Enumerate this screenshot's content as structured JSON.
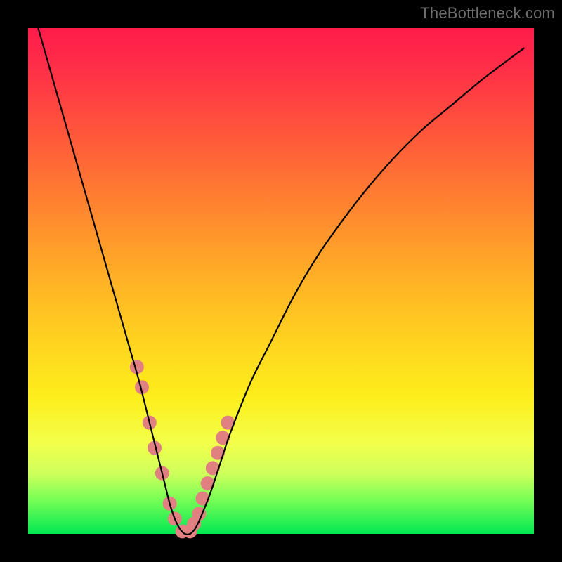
{
  "watermark": "TheBottleneck.com",
  "chart_data": {
    "type": "line",
    "title": "",
    "xlabel": "",
    "ylabel": "",
    "xlim": [
      0,
      100
    ],
    "ylim": [
      0,
      100
    ],
    "grid": false,
    "legend": false,
    "series": [
      {
        "name": "bottleneck-curve",
        "color": "#000000",
        "x": [
          2,
          4,
          6,
          8,
          10,
          12,
          14,
          16,
          18,
          20,
          22,
          24,
          25,
          26,
          27,
          28,
          29,
          30,
          31,
          32,
          33,
          34,
          36,
          38,
          40,
          44,
          48,
          52,
          56,
          60,
          66,
          72,
          78,
          84,
          90,
          98
        ],
        "y": [
          100,
          93,
          86,
          79,
          72,
          65,
          58,
          51,
          44,
          37,
          30,
          22,
          18,
          14,
          10,
          6,
          3,
          1,
          0,
          0,
          1,
          3,
          8,
          14,
          20,
          30,
          38,
          46,
          53,
          59,
          67,
          74,
          80,
          85,
          90,
          96
        ]
      }
    ],
    "markers": {
      "name": "highlight-dots",
      "color": "#e08080",
      "radius_px": 10,
      "x": [
        21.5,
        22.5,
        24.0,
        25.0,
        26.5,
        28.0,
        29.0,
        30.5,
        32.0,
        32.8,
        33.8,
        34.5,
        35.5,
        36.5,
        37.5,
        38.5,
        39.5
      ],
      "y": [
        33,
        29,
        22,
        17,
        12,
        6,
        3,
        0.5,
        0.5,
        2,
        4,
        7,
        10,
        13,
        16,
        19,
        22
      ]
    },
    "gradient_stops": [
      {
        "pos": 0,
        "color": "#ff1b4b"
      },
      {
        "pos": 22,
        "color": "#ff5a3a"
      },
      {
        "pos": 50,
        "color": "#ffb225"
      },
      {
        "pos": 73,
        "color": "#fdee1c"
      },
      {
        "pos": 93,
        "color": "#7bff55"
      },
      {
        "pos": 100,
        "color": "#00e852"
      }
    ]
  }
}
